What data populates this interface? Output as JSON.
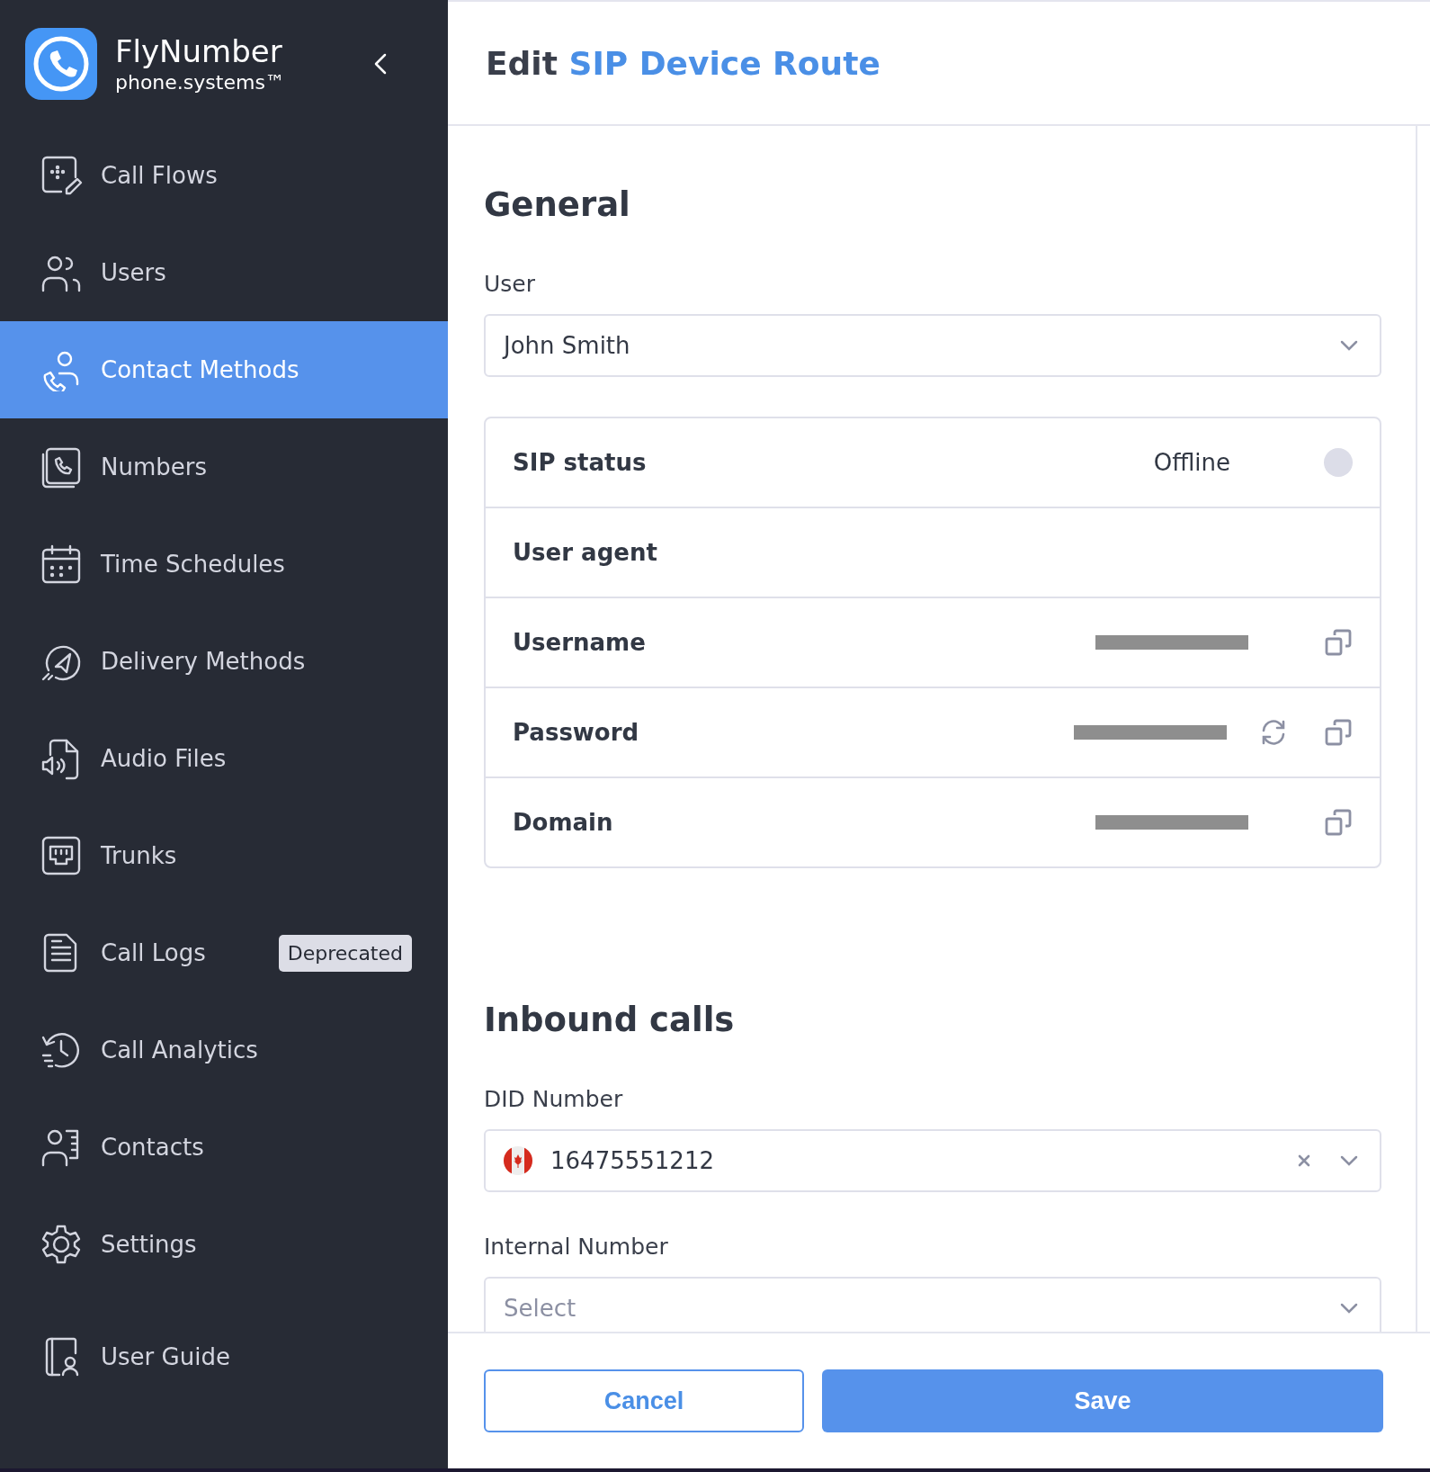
{
  "sidebar": {
    "brand": {
      "name": "FlyNumber",
      "tagline": "phone.systems™"
    },
    "items": [
      {
        "label": "Call Flows",
        "selected": false
      },
      {
        "label": "Users",
        "selected": false
      },
      {
        "label": "Contact Methods",
        "selected": true
      },
      {
        "label": "Numbers",
        "selected": false
      },
      {
        "label": "Time Schedules",
        "selected": false
      },
      {
        "label": "Delivery Methods",
        "selected": false
      },
      {
        "label": "Audio Files",
        "selected": false
      },
      {
        "label": "Trunks",
        "selected": false
      },
      {
        "label": "Call Logs",
        "selected": false,
        "badge": "Deprecated"
      },
      {
        "label": "Call Analytics",
        "selected": false
      },
      {
        "label": "Contacts",
        "selected": false
      },
      {
        "label": "Settings",
        "selected": false
      }
    ],
    "footer_item": {
      "label": "User Guide",
      "selected": false
    }
  },
  "header": {
    "title_prefix": "Edit",
    "title_highlight": "SIP Device Route"
  },
  "general": {
    "heading": "General",
    "user_label": "User",
    "user_value": "John Smith",
    "details": [
      {
        "label": "SIP status",
        "kind": "status",
        "value": "Offline",
        "color": "#dcdde8"
      },
      {
        "label": "User agent",
        "kind": "empty"
      },
      {
        "label": "Username",
        "kind": "secret",
        "redacted": true,
        "refresh": false
      },
      {
        "label": "Password",
        "kind": "secret",
        "redacted": true,
        "refresh": true
      },
      {
        "label": "Domain",
        "kind": "secret",
        "redacted": true,
        "refresh": false
      }
    ]
  },
  "inbound": {
    "heading": "Inbound calls",
    "did_label": "DID Number",
    "did_value": "16475551212",
    "internal_label": "Internal Number",
    "internal_placeholder": "Select"
  },
  "buttons": [
    {
      "label": "Cancel",
      "kind": "secondary"
    },
    {
      "label": "Save",
      "kind": "primary"
    }
  ]
}
